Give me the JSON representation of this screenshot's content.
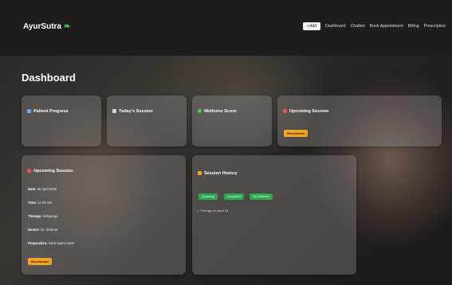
{
  "brand": {
    "name": "AyurSutra",
    "icon": "leaf-icon"
  },
  "nav": {
    "button_label": "• Add",
    "links": [
      "Dashboard",
      "Chatbot",
      "Book Appointment",
      "Billing",
      "Prescription"
    ]
  },
  "page": {
    "title": "Dashboard"
  },
  "cards": {
    "patient_progress": {
      "title": "Patient Progress"
    },
    "todays_session": {
      "title": "Today's Session"
    },
    "wellness_score": {
      "title": "Wellness Score"
    },
    "upcoming_small": {
      "title": "Upcoming Session",
      "button": "Reschedule"
    },
    "upcoming_detail": {
      "title": "Upcoming Session",
      "rows": [
        {
          "label": "Date:",
          "value": "25 April 2025"
        },
        {
          "label": "Time:",
          "value": "11:00 AM"
        },
        {
          "label": "Therapy:",
          "value": "Abhyanga"
        },
        {
          "label": "Doctor:",
          "value": "Dr. Sharma"
        },
        {
          "label": "Preparation:",
          "value": "Drink warm water"
        }
      ],
      "button": "Reschedule"
    },
    "session_history": {
      "title": "Session History",
      "pills": [
        "Upcoming",
        "Completed",
        "My Sessions"
      ],
      "item": "✓ Therapy on April 15"
    }
  },
  "colors": {
    "accent_orange": "#f0a52a",
    "accent_green": "#2fa84f",
    "nav_bg": "#1f1d1b"
  }
}
